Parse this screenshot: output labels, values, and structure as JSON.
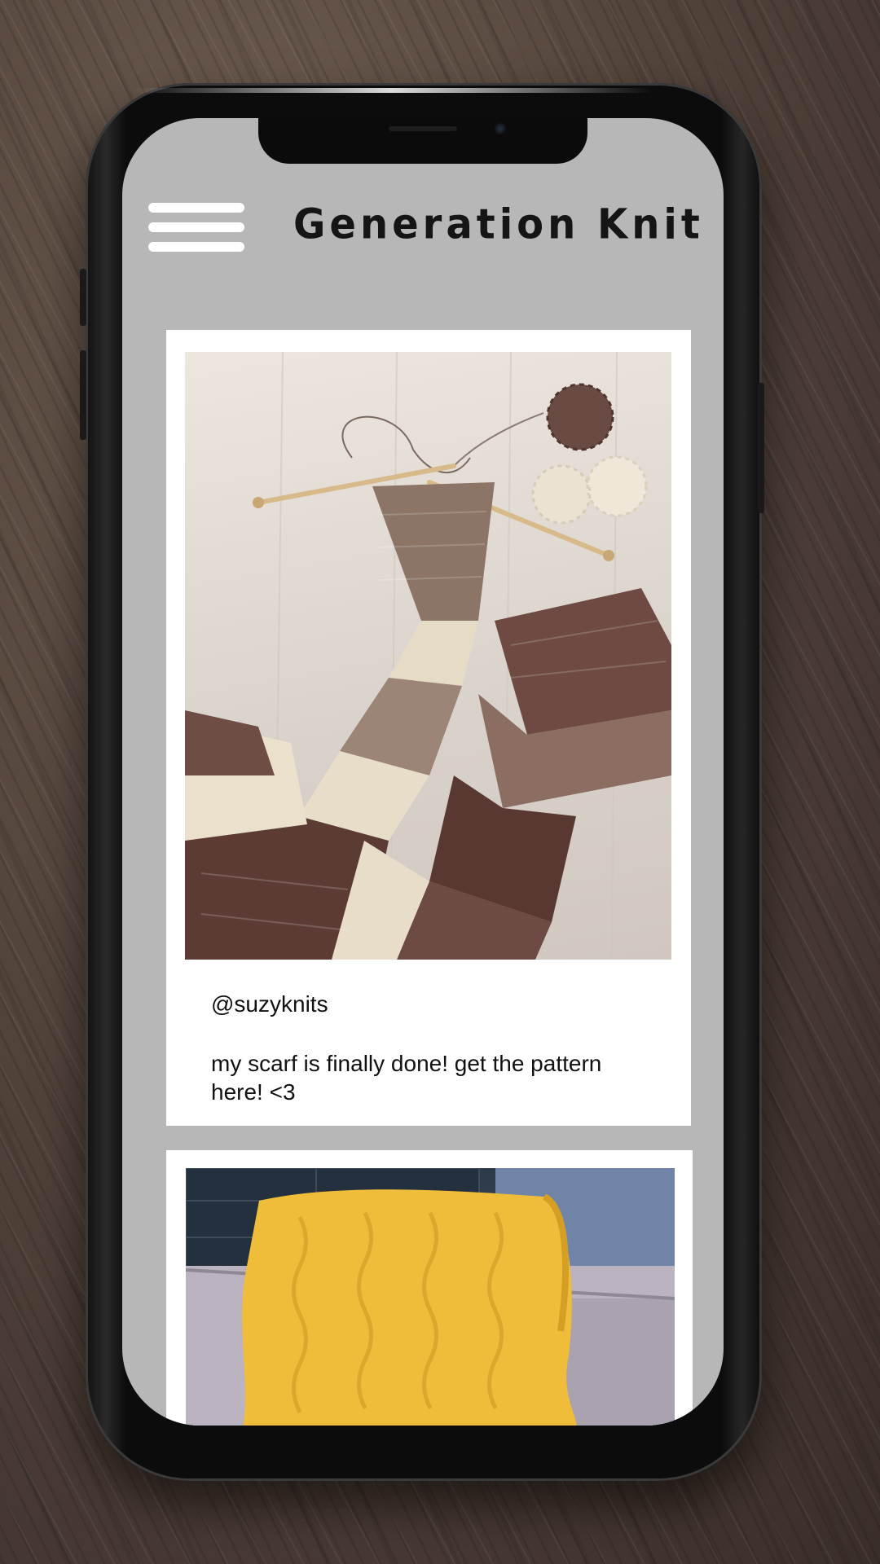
{
  "app": {
    "title": "Generation Knit",
    "menu_icon": "hamburger-menu-icon"
  },
  "feed": {
    "posts": [
      {
        "username": "@suzyknits",
        "caption": "my scarf is finally done! get the pattern here! <3",
        "photo_subject": "striped brown and cream knitted scarf with knitting needles and yarn balls"
      },
      {
        "photo_subject": "yellow cable-knit blanket on a grey sofa"
      }
    ]
  },
  "colors": {
    "screen_background": "#b7b7b7",
    "card_background": "#ffffff",
    "text": "#111111",
    "scarf_brown": "#5b3a33",
    "scarf_cream": "#e9e0cf",
    "blanket_yellow": "#f0bd3a"
  }
}
